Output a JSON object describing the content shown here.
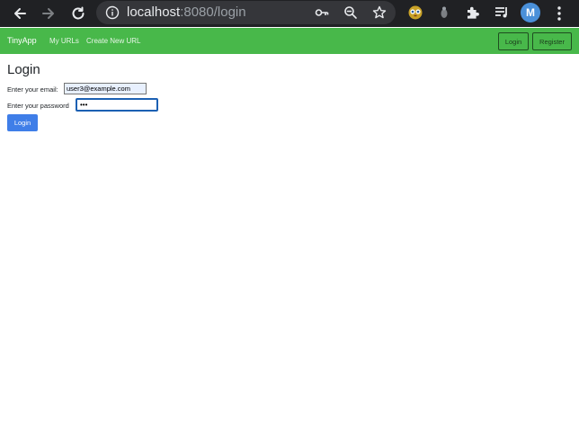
{
  "browser": {
    "url_host": "localhost",
    "url_rest": ":8080/login",
    "avatar_initial": "M"
  },
  "navbar": {
    "brand": "TinyApp",
    "links": [
      "My URLs",
      "Create New URL"
    ],
    "login_label": "Login",
    "register_label": "Register"
  },
  "login_form": {
    "title": "Login",
    "email_label": "Enter your email:",
    "email_value": "user3@example.com",
    "password_label": "Enter your password",
    "password_value": "•••",
    "submit_label": "Login"
  }
}
